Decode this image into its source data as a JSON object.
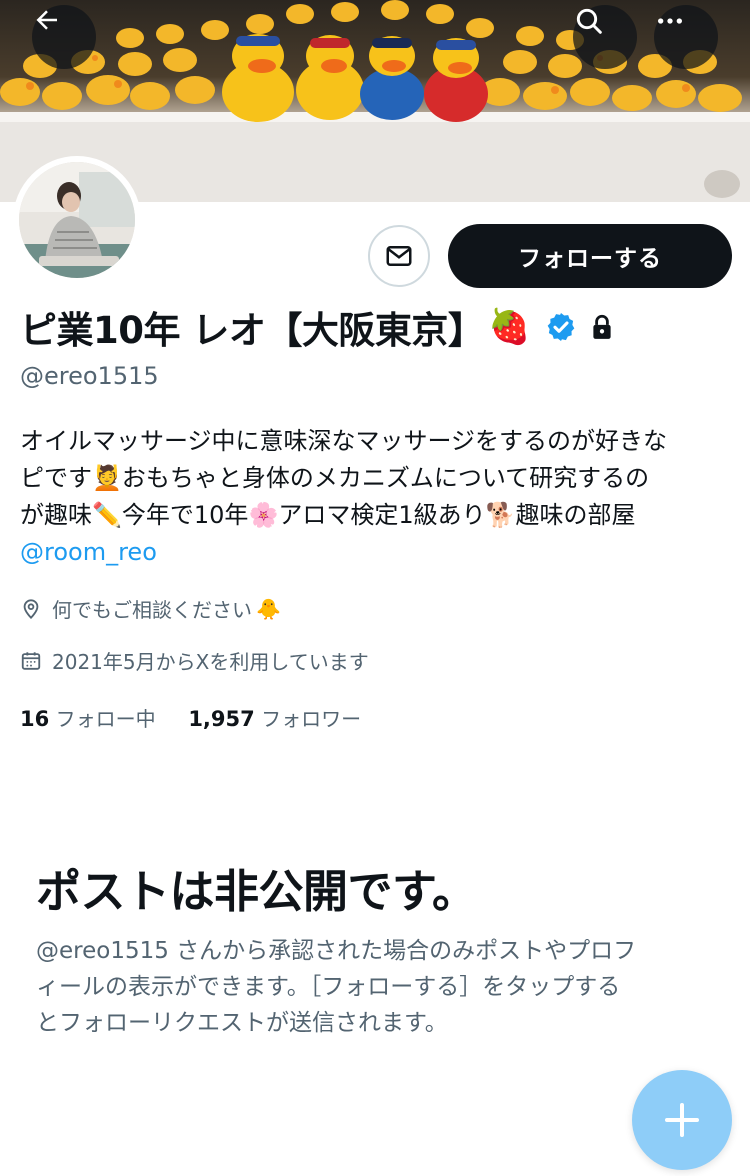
{
  "header": {
    "back_icon": "arrow-left-icon",
    "search_icon": "search-icon",
    "more_icon": "more-icon"
  },
  "profile": {
    "display_name": "ピ業10年 レオ【大阪東京】",
    "name_emoji": "🍓",
    "handle": "@ereo1515",
    "follow_label": "フォローする",
    "bio_lines": [
      "オイルマッサージ中に意味深なマッサージをするのが好きな",
      "ピです",
      "おもちゃと身体のメカニズムについて研究するの",
      "が趣味",
      "今年で10年",
      "アロマ検定1級あり",
      "趣味の部屋"
    ],
    "bio_emojis": [
      "💆",
      "✏️",
      "🌸",
      "🐕"
    ],
    "bio_mention": "@room_reo",
    "location": "何でもご相談ください",
    "location_emoji": "🐥",
    "joined": "2021年5月からXを利用しています",
    "following_count": "16",
    "following_label": "フォロー中",
    "followers_count": "1,957",
    "followers_label": "フォロワー"
  },
  "private_notice": {
    "title": "ポストは非公開です。",
    "lines": [
      "@ereo1515 さんから承認された場合のみポストやプロフ",
      "ィールの表示ができます。［フォローする］をタップする",
      "とフォローリクエストが送信されます。"
    ]
  },
  "fab": {
    "icon": "plus-icon"
  },
  "colors": {
    "accent": "#1d9bf0",
    "text": "#0f1419",
    "muted": "#536471",
    "fab": "#8ecdf8"
  }
}
